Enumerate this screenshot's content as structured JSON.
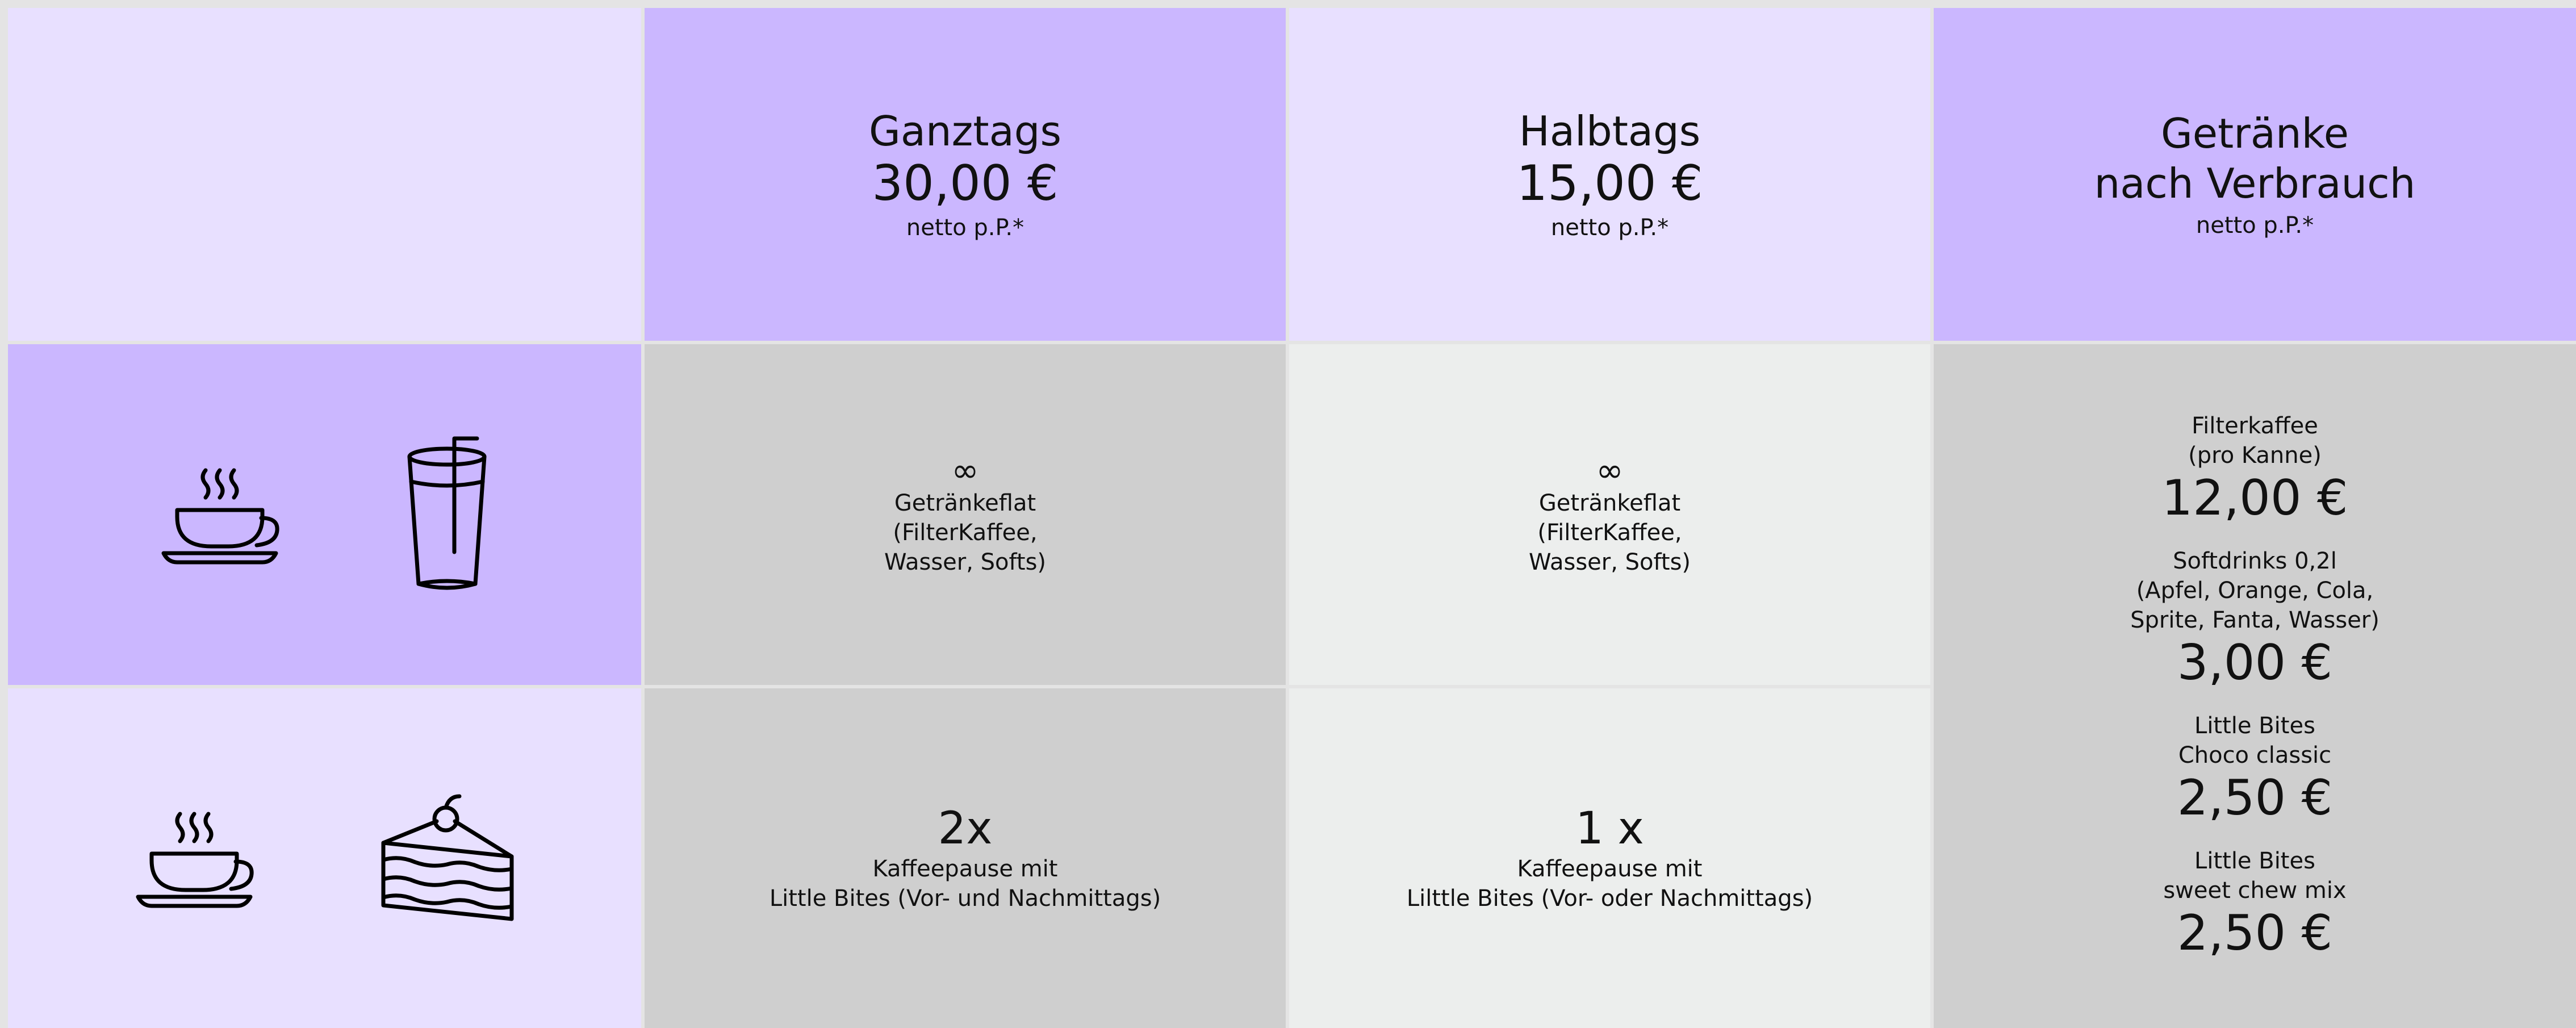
{
  "header": {
    "ganztags": {
      "title": "Ganztags",
      "price": "30,00 €",
      "note": "netto p.P.*"
    },
    "halbtags": {
      "title": "Halbtags",
      "price": "15,00 €",
      "note": "netto p.P.*"
    },
    "verbrauch": {
      "title_line1": "Getränke",
      "title_line2": "nach Verbrauch",
      "note": "netto p.P.*"
    }
  },
  "drinks_row": {
    "icons": [
      "coffee-cup-icon",
      "glass-with-straw-icon"
    ],
    "ganztags": {
      "symbol": "∞",
      "desc": "Getränkeflat\n(FilterKaffee,\nWasser, Softs)"
    },
    "halbtags": {
      "symbol": "∞",
      "desc": "Getränkeflat\n(FilterKaffee,\nWasser, Softs)"
    }
  },
  "break_row": {
    "icons": [
      "coffee-cup-icon",
      "cake-slice-icon"
    ],
    "ganztags": {
      "count": "2x",
      "desc": "Kaffeepause mit\nLittle Bites (Vor- und Nachmittags)"
    },
    "halbtags": {
      "count": "1 x",
      "desc": "Kaffeepause mit\nLilttle Bites (Vor- oder Nachmittags)"
    }
  },
  "consumption": [
    {
      "desc": "Filterkaffee\n(pro Kanne)",
      "price": "12,00 €"
    },
    {
      "desc": "Softdrinks 0,2l\n(Apfel, Orange, Cola,\nSprite, Fanta, Wasser)",
      "price": "3,00 €"
    },
    {
      "desc": "Little Bites\nChoco classic",
      "price": "2,50 €"
    },
    {
      "desc": "Little Bites\nsweet chew mix",
      "price": "2,50 €"
    }
  ],
  "colors": {
    "lavender_light": "#e8e0ff",
    "lavender_dark": "#cbb7ff",
    "gray": "#cfcfcf",
    "light_gray": "#eceeed"
  }
}
